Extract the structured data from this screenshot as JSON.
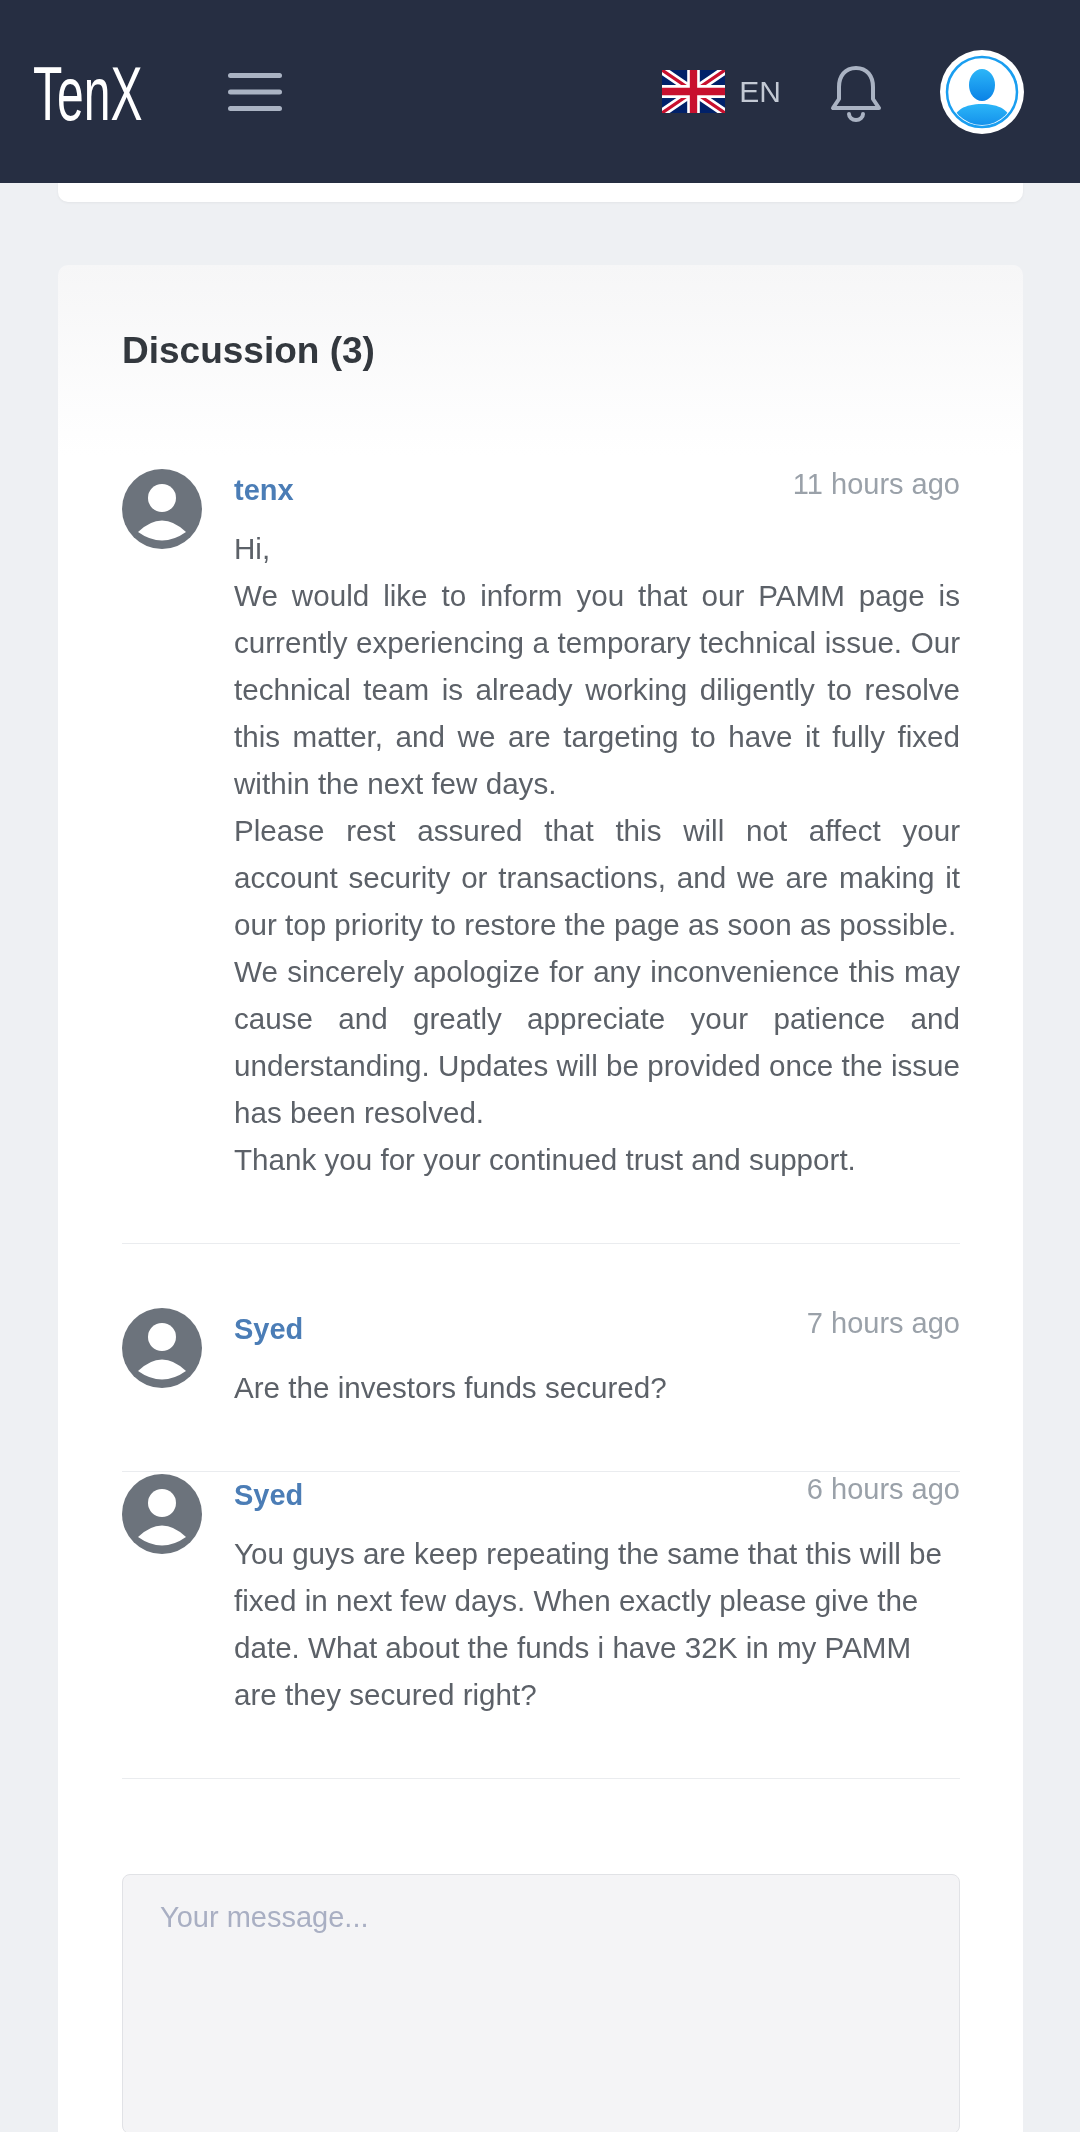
{
  "header": {
    "brand": "TenX",
    "language": {
      "code": "EN"
    }
  },
  "discussion": {
    "title": "Discussion (3)",
    "comments": [
      {
        "author": "tenx",
        "time": "11 hours ago",
        "paragraphs": [
          "Hi,",
          "We would like to inform you that our PAMM page is currently experiencing a temporary technical issue. Our technical team is already working diligently to resolve this matter, and we are targeting to have it fully fixed within the next few days.",
          "Please rest assured that this will not affect your account security or transactions, and we are making it our top priority to restore the page as soon as possible.",
          "We sincerely apologize for any inconvenience this may cause and greatly appreciate your patience and understanding. Updates will be provided once the issue has been resolved.",
          "Thank you for your continued trust and support."
        ]
      },
      {
        "author": "Syed",
        "time": "7 hours ago",
        "paragraphs": [
          "Are the investors funds secured?"
        ]
      },
      {
        "author": "Syed",
        "time": "6 hours ago",
        "paragraphs": [
          "You guys are keep repeating the same that this will be fixed in next few days. When exactly please give the date. What about the funds i have 32K in my PAMM are they secured right?"
        ]
      }
    ]
  },
  "composer": {
    "placeholder": "Your message..."
  }
}
